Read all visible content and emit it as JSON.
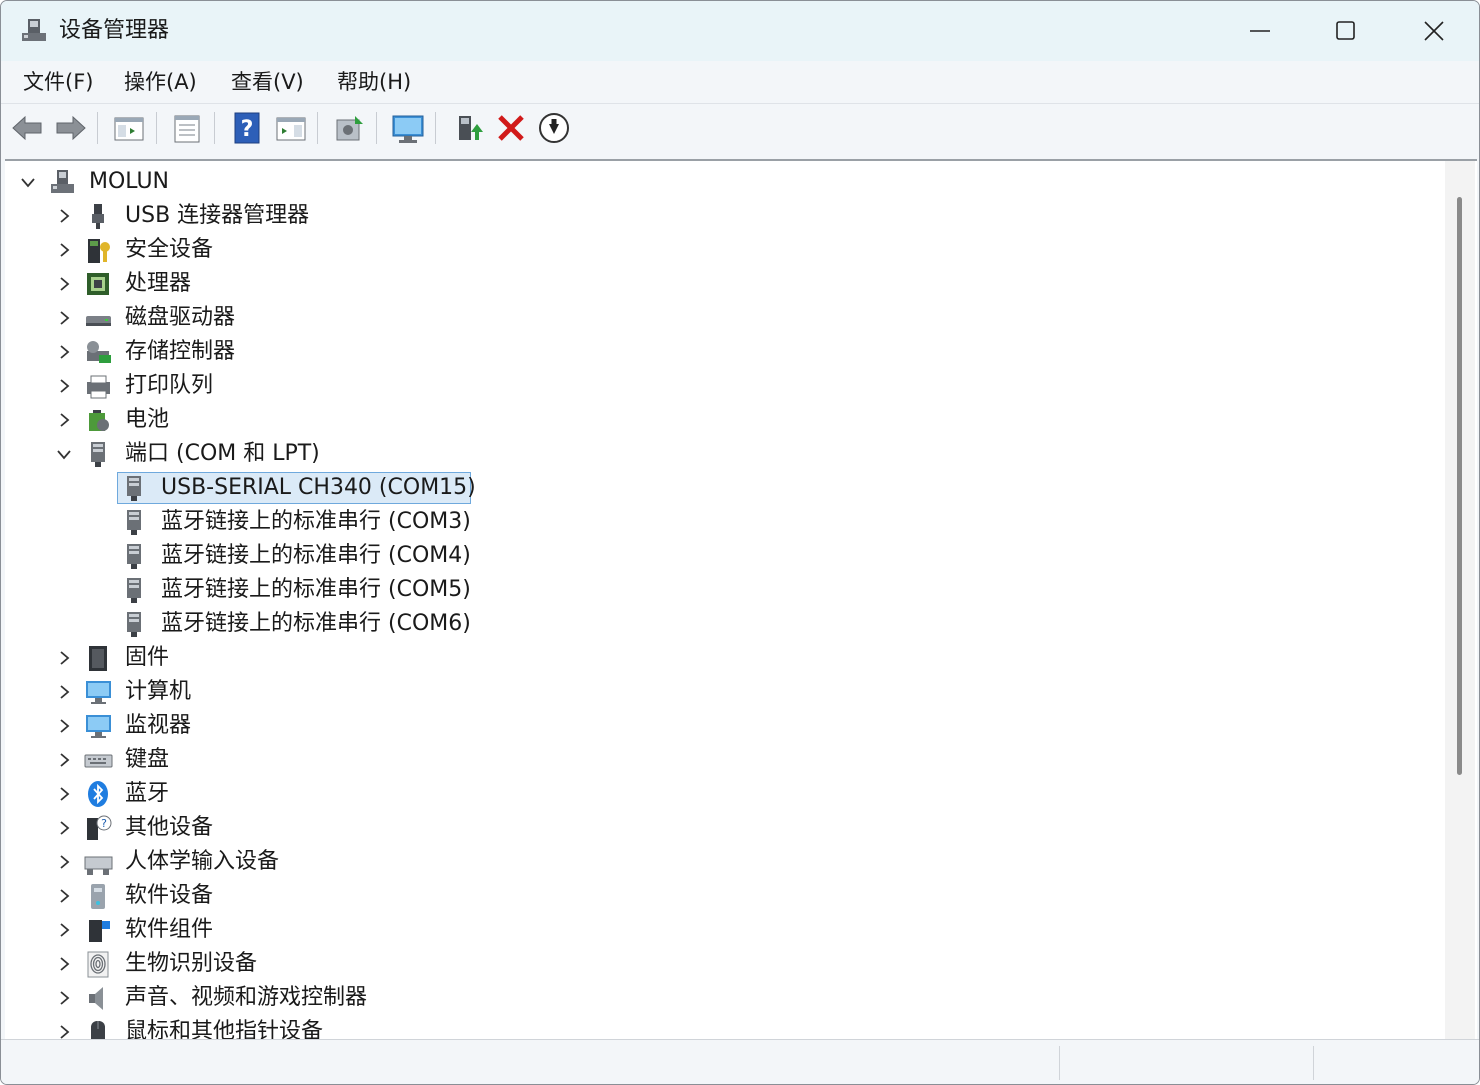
{
  "window": {
    "title": "设备管理器",
    "controls": {
      "minimize_icon": "minimize-icon",
      "maximize_icon": "maximize-icon",
      "close_icon": "close-icon"
    }
  },
  "menu": [
    "文件(F)",
    "操作(A)",
    "查看(V)",
    "帮助(H)"
  ],
  "toolbar": [
    "back-arrow-icon",
    "forward-arrow-icon",
    "show-hide-console-tree-icon",
    "properties-icon",
    "help-icon",
    "show-action-pane-icon",
    "update-driver-icon",
    "scan-hardware-changes-icon",
    "enable-device-icon",
    "uninstall-device-icon",
    "disable-device-icon"
  ],
  "tree": {
    "root": {
      "label": "MOLUN",
      "expanded": true,
      "icon": "computer-icon"
    },
    "items": [
      {
        "label": "USB 连接器管理器",
        "icon": "usb-connector-icon",
        "expanded": false
      },
      {
        "label": "安全设备",
        "icon": "security-key-icon",
        "expanded": false
      },
      {
        "label": "处理器",
        "icon": "processor-icon",
        "expanded": false
      },
      {
        "label": "磁盘驱动器",
        "icon": "disk-drive-icon",
        "expanded": false
      },
      {
        "label": "存储控制器",
        "icon": "storage-controller-icon",
        "expanded": false
      },
      {
        "label": "打印队列",
        "icon": "printer-icon",
        "expanded": false
      },
      {
        "label": "电池",
        "icon": "battery-icon",
        "expanded": false
      },
      {
        "label": "端口 (COM 和 LPT)",
        "icon": "port-icon",
        "expanded": true,
        "children": [
          {
            "label": "USB-SERIAL CH340 (COM15)",
            "selected": true
          },
          {
            "label": "蓝牙链接上的标准串行 (COM3)"
          },
          {
            "label": "蓝牙链接上的标准串行 (COM4)"
          },
          {
            "label": "蓝牙链接上的标准串行 (COM5)"
          },
          {
            "label": "蓝牙链接上的标准串行 (COM6)"
          }
        ]
      },
      {
        "label": "固件",
        "icon": "firmware-icon",
        "expanded": false
      },
      {
        "label": "计算机",
        "icon": "monitor-computer-icon",
        "expanded": false
      },
      {
        "label": "监视器",
        "icon": "monitor-icon",
        "expanded": false
      },
      {
        "label": "键盘",
        "icon": "keyboard-icon",
        "expanded": false
      },
      {
        "label": "蓝牙",
        "icon": "bluetooth-icon",
        "expanded": false
      },
      {
        "label": "其他设备",
        "icon": "unknown-device-icon",
        "expanded": false
      },
      {
        "label": "人体学输入设备",
        "icon": "hid-icon",
        "expanded": false
      },
      {
        "label": "软件设备",
        "icon": "software-device-icon",
        "expanded": false
      },
      {
        "label": "软件组件",
        "icon": "software-component-icon",
        "expanded": false
      },
      {
        "label": "生物识别设备",
        "icon": "fingerprint-icon",
        "expanded": false
      },
      {
        "label": "声音、视频和游戏控制器",
        "icon": "speaker-icon",
        "expanded": false
      },
      {
        "label": "鼠标和其他指针设备",
        "icon": "mouse-icon",
        "expanded": false
      }
    ]
  },
  "colors": {
    "selection_bg": "#dbeaf7",
    "selection_border": "#6fa9dd",
    "titlebar_bg": "#e9f4f8"
  }
}
